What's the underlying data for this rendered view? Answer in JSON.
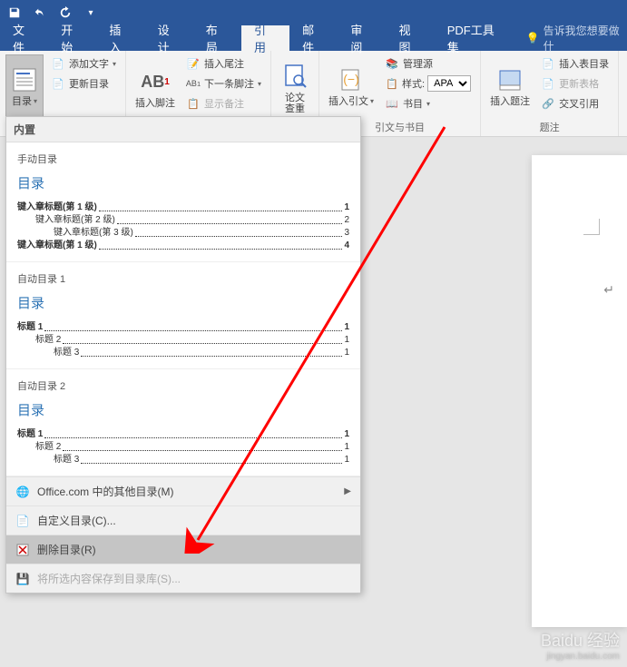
{
  "titlebar": {},
  "tabs": {
    "items": [
      "文件",
      "开始",
      "插入",
      "设计",
      "布局",
      "引用",
      "邮件",
      "审阅",
      "视图",
      "PDF工具集"
    ],
    "active_index": 5,
    "tell_me": "告诉我您想要做什"
  },
  "ribbon": {
    "toc": {
      "label": "目录",
      "add_text": "添加文字",
      "update": "更新目录"
    },
    "footnotes": {
      "big": "插入脚注",
      "insert_endnote": "插入尾注",
      "next_footnote": "下一条脚注",
      "show_notes": "显示备注",
      "ab": "AB",
      "ab_sup": "1"
    },
    "lookup": {
      "label": "论文\n查重"
    },
    "citation": {
      "big": "插入引文",
      "manage": "管理源",
      "style_label": "样式:",
      "style_value": "APA",
      "biblio": "书目",
      "group_label": "引文与书目"
    },
    "caption": {
      "big": "插入题注",
      "insert_table_fig": "插入表目录",
      "update_table": "更新表格",
      "crossref": "交叉引用",
      "group_label": "题注"
    }
  },
  "toc_menu": {
    "builtin": "内置",
    "items": [
      {
        "name": "手动目录",
        "title": "目录",
        "lines": [
          {
            "lvl": 1,
            "t": "键入章标题(第 1 级)",
            "p": "1"
          },
          {
            "lvl": 2,
            "t": "键入章标题(第 2 级)",
            "p": "2"
          },
          {
            "lvl": 3,
            "t": "键入章标题(第 3 级)",
            "p": "3"
          },
          {
            "lvl": 1,
            "t": "键入章标题(第 1 级)",
            "p": "4"
          }
        ]
      },
      {
        "name": "自动目录 1",
        "title": "目录",
        "lines": [
          {
            "lvl": 1,
            "t": "标题 1",
            "p": "1"
          },
          {
            "lvl": 2,
            "t": "标题 2",
            "p": "1"
          },
          {
            "lvl": 3,
            "t": "标题 3",
            "p": "1"
          }
        ]
      },
      {
        "name": "自动目录 2",
        "title": "目录",
        "lines": [
          {
            "lvl": 1,
            "t": "标题 1",
            "p": "1"
          },
          {
            "lvl": 2,
            "t": "标题 2",
            "p": "1"
          },
          {
            "lvl": 3,
            "t": "标题 3",
            "p": "1"
          }
        ]
      }
    ],
    "footer": {
      "more": "Office.com 中的其他目录(M)",
      "custom": "自定义目录(C)...",
      "remove": "删除目录(R)",
      "save": "将所选内容保存到目录库(S)..."
    }
  },
  "watermark": {
    "brand": "Baidu 经验",
    "url": "jingyan.baidu.com"
  }
}
